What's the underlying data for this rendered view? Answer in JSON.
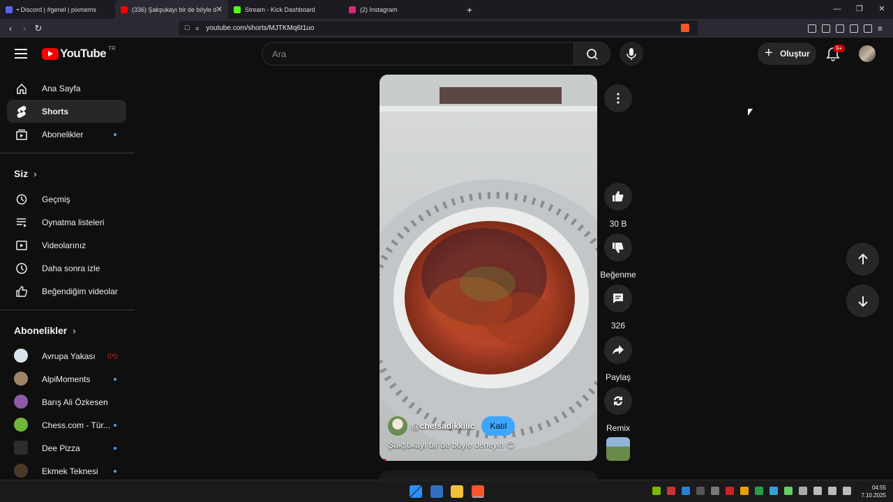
{
  "browser": {
    "tabs": [
      {
        "label": "• Discord | #genel | pixmems",
        "color": "#5865f2",
        "active": false
      },
      {
        "label": "(336) Şakşukayı bir de böyle d",
        "color": "#ff0000",
        "active": true
      },
      {
        "label": "Stream - Kick Dashboard",
        "color": "#53fc18",
        "active": false
      },
      {
        "label": "(2) Instagram",
        "color": "#d62976",
        "active": false
      }
    ],
    "url": "youtube.com/shorts/MJTKMq6t1uo"
  },
  "header": {
    "logo_text": "YouTube",
    "country_code": "TR",
    "search_placeholder": "Ara",
    "create_label": "Oluştur",
    "notification_badge": "9+"
  },
  "sidebar": {
    "main": [
      {
        "label": "Ana Sayfa",
        "icon": "home-icon"
      },
      {
        "label": "Shorts",
        "icon": "shorts-icon",
        "active": true
      },
      {
        "label": "Abonelikler",
        "icon": "subscriptions-icon",
        "dot": true
      }
    ],
    "you_heading": "Siz",
    "you": [
      {
        "label": "Geçmiş",
        "icon": "history-icon"
      },
      {
        "label": "Oynatma listeleri",
        "icon": "playlists-icon"
      },
      {
        "label": "Videolarınız",
        "icon": "your-videos-icon"
      },
      {
        "label": "Daha sonra izle",
        "icon": "watch-later-icon"
      },
      {
        "label": "Beğendiğim videolar",
        "icon": "liked-videos-icon"
      }
    ],
    "subs_heading": "Abonelikler",
    "subs": [
      {
        "label": "Avrupa Yakası",
        "color": "#d7e4ea",
        "status": "live"
      },
      {
        "label": "AlpiMoments",
        "color": "#a08468",
        "status": "dot"
      },
      {
        "label": "Barış Ali Özkesen",
        "color": "#8e5aa8",
        "status": "none"
      },
      {
        "label": "Chess.com - Tür...",
        "color": "#6fb63a",
        "status": "dot"
      },
      {
        "label": "Dee Pizza",
        "color": "#2d2d2d",
        "status": "dot"
      },
      {
        "label": "Ekmek Teknesi",
        "color": "#4a3a28",
        "status": "dot"
      }
    ]
  },
  "short": {
    "channel": "@chefsadikkilic",
    "join_label": "Katıl",
    "caption": "Şakşukayı bir de böyle deneyin 😊",
    "progress": 0.03
  },
  "actions": {
    "like_label": "30 B",
    "dislike_label": "Beğenme",
    "comments_label": "326",
    "share_label": "Paylaş",
    "remix_label": "Remix"
  },
  "taskbar": {
    "time": "04:55",
    "date": "7.10.2025"
  }
}
